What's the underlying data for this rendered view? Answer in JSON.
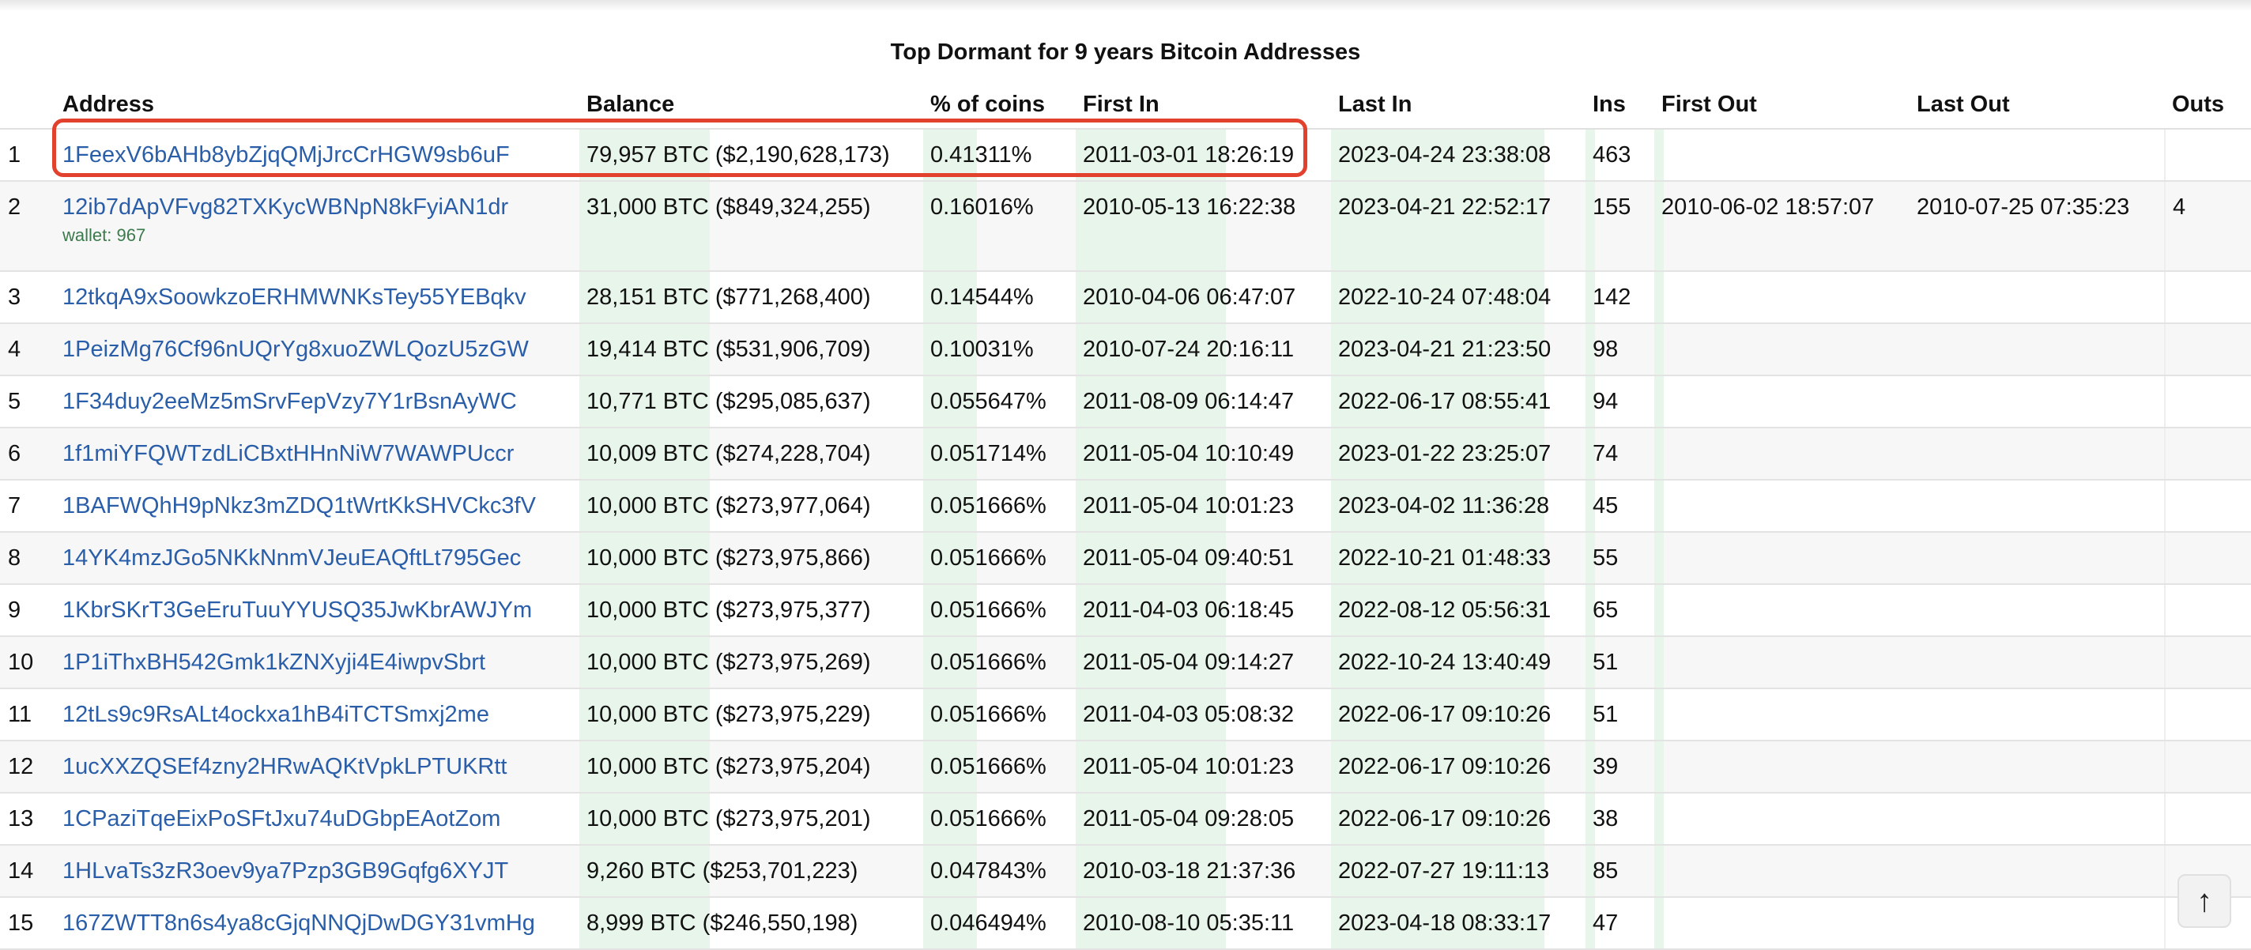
{
  "page": {
    "title": "Top Dormant for 9 years Bitcoin Addresses"
  },
  "table": {
    "headers": {
      "rank": "",
      "address": "Address",
      "balance": "Balance",
      "pct": "% of coins",
      "first_in": "First In",
      "last_in": "Last In",
      "ins": "Ins",
      "first_out": "First Out",
      "last_out": "Last Out",
      "outs": "Outs"
    },
    "rows": [
      {
        "rank": "1",
        "address": "1FeexV6bAHb8ybZjqQMjJrcCrHGW9sb6uF",
        "wallet": "",
        "balance": "79,957 BTC ($2,190,628,173)",
        "pct": "0.41311%",
        "first_in": "2011-03-01 18:26:19",
        "last_in": "2023-04-24 23:38:08",
        "ins": "463",
        "first_out": "",
        "last_out": "",
        "outs": "",
        "highlighted": true
      },
      {
        "rank": "2",
        "address": "12ib7dApVFvg82TXKycWBNpN8kFyiAN1dr",
        "wallet": "wallet: 967",
        "balance": "31,000 BTC ($849,324,255)",
        "pct": "0.16016%",
        "first_in": "2010-05-13 16:22:38",
        "last_in": "2023-04-21 22:52:17",
        "ins": "155",
        "first_out": "2010-06-02 18:57:07",
        "last_out": "2010-07-25 07:35:23",
        "outs": "4"
      },
      {
        "rank": "3",
        "address": "12tkqA9xSoowkzoERHMWNKsTey55YEBqkv",
        "wallet": "",
        "balance": "28,151 BTC ($771,268,400)",
        "pct": "0.14544%",
        "first_in": "2010-04-06 06:47:07",
        "last_in": "2022-10-24 07:48:04",
        "ins": "142",
        "first_out": "",
        "last_out": "",
        "outs": ""
      },
      {
        "rank": "4",
        "address": "1PeizMg76Cf96nUQrYg8xuoZWLQozU5zGW",
        "wallet": "",
        "balance": "19,414 BTC ($531,906,709)",
        "pct": "0.10031%",
        "first_in": "2010-07-24 20:16:11",
        "last_in": "2023-04-21 21:23:50",
        "ins": "98",
        "first_out": "",
        "last_out": "",
        "outs": ""
      },
      {
        "rank": "5",
        "address": "1F34duy2eeMz5mSrvFepVzy7Y1rBsnAyWC",
        "wallet": "",
        "balance": "10,771 BTC ($295,085,637)",
        "pct": "0.055647%",
        "first_in": "2011-08-09 06:14:47",
        "last_in": "2022-06-17 08:55:41",
        "ins": "94",
        "first_out": "",
        "last_out": "",
        "outs": ""
      },
      {
        "rank": "6",
        "address": "1f1miYFQWTzdLiCBxtHHnNiW7WAWPUccr",
        "wallet": "",
        "balance": "10,009 BTC ($274,228,704)",
        "pct": "0.051714%",
        "first_in": "2011-05-04 10:10:49",
        "last_in": "2023-01-22 23:25:07",
        "ins": "74",
        "first_out": "",
        "last_out": "",
        "outs": ""
      },
      {
        "rank": "7",
        "address": "1BAFWQhH9pNkz3mZDQ1tWrtKkSHVCkc3fV",
        "wallet": "",
        "balance": "10,000 BTC ($273,977,064)",
        "pct": "0.051666%",
        "first_in": "2011-05-04 10:01:23",
        "last_in": "2023-04-02 11:36:28",
        "ins": "45",
        "first_out": "",
        "last_out": "",
        "outs": ""
      },
      {
        "rank": "8",
        "address": "14YK4mzJGo5NKkNnmVJeuEAQftLt795Gec",
        "wallet": "",
        "balance": "10,000 BTC ($273,975,866)",
        "pct": "0.051666%",
        "first_in": "2011-05-04 09:40:51",
        "last_in": "2022-10-21 01:48:33",
        "ins": "55",
        "first_out": "",
        "last_out": "",
        "outs": ""
      },
      {
        "rank": "9",
        "address": "1KbrSKrT3GeEruTuuYYUSQ35JwKbrAWJYm",
        "wallet": "",
        "balance": "10,000 BTC ($273,975,377)",
        "pct": "0.051666%",
        "first_in": "2011-04-03 06:18:45",
        "last_in": "2022-08-12 05:56:31",
        "ins": "65",
        "first_out": "",
        "last_out": "",
        "outs": ""
      },
      {
        "rank": "10",
        "address": "1P1iThxBH542Gmk1kZNXyji4E4iwpvSbrt",
        "wallet": "",
        "balance": "10,000 BTC ($273,975,269)",
        "pct": "0.051666%",
        "first_in": "2011-05-04 09:14:27",
        "last_in": "2022-10-24 13:40:49",
        "ins": "51",
        "first_out": "",
        "last_out": "",
        "outs": ""
      },
      {
        "rank": "11",
        "address": "12tLs9c9RsALt4ockxa1hB4iTCTSmxj2me",
        "wallet": "",
        "balance": "10,000 BTC ($273,975,229)",
        "pct": "0.051666%",
        "first_in": "2011-04-03 05:08:32",
        "last_in": "2022-06-17 09:10:26",
        "ins": "51",
        "first_out": "",
        "last_out": "",
        "outs": ""
      },
      {
        "rank": "12",
        "address": "1ucXXZQSEf4zny2HRwAQKtVpkLPTUKRtt",
        "wallet": "",
        "balance": "10,000 BTC ($273,975,204)",
        "pct": "0.051666%",
        "first_in": "2011-05-04 10:01:23",
        "last_in": "2022-06-17 09:10:26",
        "ins": "39",
        "first_out": "",
        "last_out": "",
        "outs": ""
      },
      {
        "rank": "13",
        "address": "1CPaziTqeEixPoSFtJxu74uDGbpEAotZom",
        "wallet": "",
        "balance": "10,000 BTC ($273,975,201)",
        "pct": "0.051666%",
        "first_in": "2011-05-04 09:28:05",
        "last_in": "2022-06-17 09:10:26",
        "ins": "38",
        "first_out": "",
        "last_out": "",
        "outs": ""
      },
      {
        "rank": "14",
        "address": "1HLvaTs3zR3oev9ya7Pzp3GB9Gqfg6XYJT",
        "wallet": "",
        "balance": "9,260 BTC ($253,701,223)",
        "pct": "0.047843%",
        "first_in": "2010-03-18 21:37:36",
        "last_in": "2022-07-27 19:11:13",
        "ins": "85",
        "first_out": "",
        "last_out": "",
        "outs": ""
      },
      {
        "rank": "15",
        "address": "167ZWTT8n6s4ya8cGjqNNQjDwDGY31vmHg",
        "wallet": "",
        "balance": "8,999 BTC ($246,550,198)",
        "pct": "0.046494%",
        "first_in": "2010-08-10 05:35:11",
        "last_in": "2023-04-18 08:33:17",
        "ins": "47",
        "first_out": "",
        "last_out": "",
        "outs": ""
      }
    ]
  },
  "scroll_top": {
    "label": "↑"
  },
  "colors": {
    "link": "#2b5ea8",
    "wallet_tag": "#3b7a4b",
    "highlight_border": "#e2412e",
    "bar_fill": "#e7f5ea",
    "row_stripe": "#f7f7f7"
  }
}
